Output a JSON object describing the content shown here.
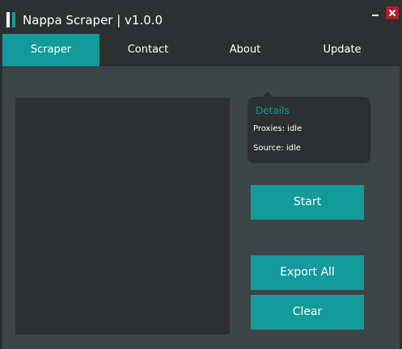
{
  "window": {
    "title": "Nappa Scraper | v1.0.0",
    "accent_color": "#139a9a",
    "close_color": "#b01e28"
  },
  "tabs": [
    {
      "label": "Scraper",
      "active": true
    },
    {
      "label": "Contact",
      "active": false
    },
    {
      "label": "About",
      "active": false
    },
    {
      "label": "Update",
      "active": false
    }
  ],
  "details": {
    "title": "Details",
    "proxies": "Proxies: idle",
    "source": "Source: idle"
  },
  "actions": {
    "start": "Start",
    "export_all": "Export All",
    "clear": "Clear"
  }
}
